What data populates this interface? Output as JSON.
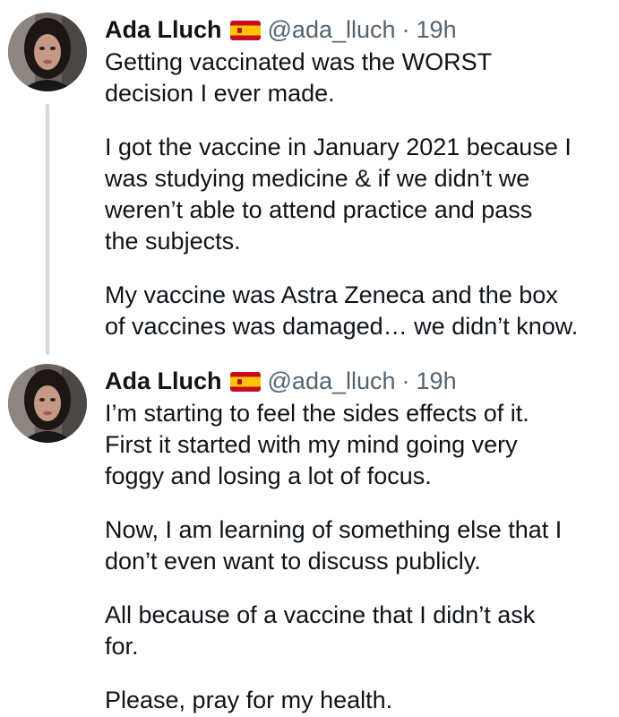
{
  "tweets": [
    {
      "author": {
        "name": "Ada Lluch",
        "flag": "spain-flag-icon",
        "handle": "@ada_lluch",
        "separator": "·",
        "time": "19h"
      },
      "paragraphs": [
        "Getting vaccinated was the WORST\ndecision I ever made.",
        "I got the vaccine in January 2021 because I\nwas studying medicine & if we didn’t we\nweren’t able to attend practice and pass\nthe subjects.",
        "My vaccine was Astra Zeneca and the box\nof vaccines was damaged… we didn’t know."
      ]
    },
    {
      "author": {
        "name": "Ada Lluch",
        "flag": "spain-flag-icon",
        "handle": "@ada_lluch",
        "separator": "·",
        "time": "19h"
      },
      "paragraphs": [
        "I’m starting to feel the sides effects of it.\nFirst it started with my mind going very\nfoggy and losing a lot of focus.",
        "Now, I am learning of something else that I\ndon’t even want to discuss publicly.",
        "All because of a vaccine that I didn’t ask\nfor.",
        "Please, pray for my health."
      ]
    }
  ],
  "colors": {
    "text": "#0f1419",
    "secondary": "#536471",
    "thread_line": "#cfd9de",
    "flag_red": "#c60b1e",
    "flag_yellow": "#ffc400"
  }
}
